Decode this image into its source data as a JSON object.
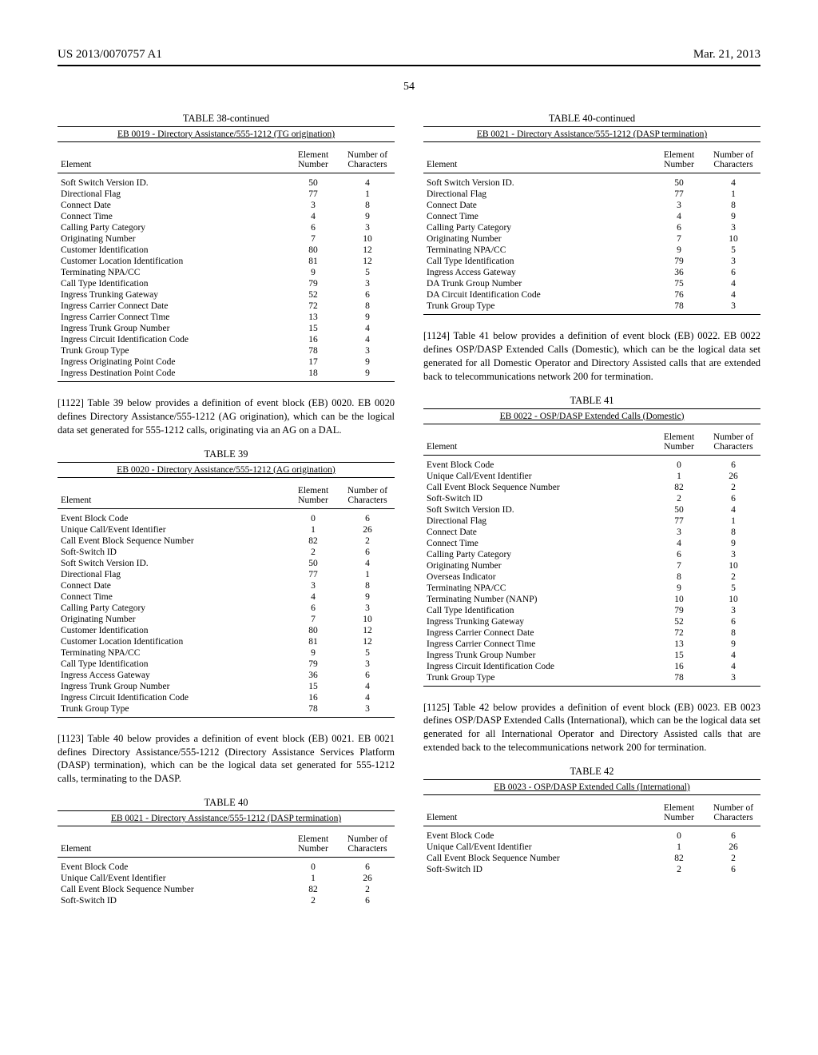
{
  "header": {
    "pub": "US 2013/0070757 A1",
    "date": "Mar. 21, 2013",
    "pagenum": "54"
  },
  "table38": {
    "label": "TABLE 38-continued",
    "caption": "EB 0019 - Directory Assistance/555-1212 (TG origination)",
    "head": {
      "c1": "Element",
      "c2": "Element\nNumber",
      "c3": "Number of\nCharacters"
    },
    "rows": [
      [
        "Soft Switch Version ID.",
        "50",
        "4"
      ],
      [
        "Directional Flag",
        "77",
        "1"
      ],
      [
        "Connect Date",
        "3",
        "8"
      ],
      [
        "Connect Time",
        "4",
        "9"
      ],
      [
        "Calling Party Category",
        "6",
        "3"
      ],
      [
        "Originating Number",
        "7",
        "10"
      ],
      [
        "Customer Identification",
        "80",
        "12"
      ],
      [
        "Customer Location Identification",
        "81",
        "12"
      ],
      [
        "Terminating NPA/CC",
        "9",
        "5"
      ],
      [
        "Call Type Identification",
        "79",
        "3"
      ],
      [
        "Ingress Trunking Gateway",
        "52",
        "6"
      ],
      [
        "Ingress Carrier Connect Date",
        "72",
        "8"
      ],
      [
        "Ingress Carrier Connect Time",
        "13",
        "9"
      ],
      [
        "Ingress Trunk Group Number",
        "15",
        "4"
      ],
      [
        "Ingress Circuit Identification Code",
        "16",
        "4"
      ],
      [
        "Trunk Group Type",
        "78",
        "3"
      ],
      [
        "Ingress Originating Point Code",
        "17",
        "9"
      ],
      [
        "Ingress Destination Point Code",
        "18",
        "9"
      ]
    ]
  },
  "para1122": "[1122]   Table 39 below provides a definition of event block (EB) 0020. EB 0020 defines Directory Assistance/555-1212 (AG origination), which can be the logical data set generated for 555-1212 calls, originating via an AG on a DAL.",
  "table39": {
    "label": "TABLE 39",
    "caption": "EB 0020 - Directory Assistance/555-1212 (AG origination)",
    "head": {
      "c1": "Element",
      "c2": "Element\nNumber",
      "c3": "Number of\nCharacters"
    },
    "rows": [
      [
        "Event Block Code",
        "0",
        "6"
      ],
      [
        "Unique Call/Event Identifier",
        "1",
        "26"
      ],
      [
        "Call Event Block Sequence Number",
        "82",
        "2"
      ],
      [
        "Soft-Switch ID",
        "2",
        "6"
      ],
      [
        "Soft Switch Version ID.",
        "50",
        "4"
      ],
      [
        "Directional Flag",
        "77",
        "1"
      ],
      [
        "Connect Date",
        "3",
        "8"
      ],
      [
        "Connect Time",
        "4",
        "9"
      ],
      [
        "Calling Party Category",
        "6",
        "3"
      ],
      [
        "Originating Number",
        "7",
        "10"
      ],
      [
        "Customer Identification",
        "80",
        "12"
      ],
      [
        "Customer Location Identification",
        "81",
        "12"
      ],
      [
        "Terminating NPA/CC",
        "9",
        "5"
      ],
      [
        "Call Type Identification",
        "79",
        "3"
      ],
      [
        "Ingress Access Gateway",
        "36",
        "6"
      ],
      [
        "Ingress Trunk Group Number",
        "15",
        "4"
      ],
      [
        "Ingress Circuit Identification Code",
        "16",
        "4"
      ],
      [
        "Trunk Group Type",
        "78",
        "3"
      ]
    ]
  },
  "para1123": "[1123]   Table 40 below provides a definition of event block (EB) 0021. EB 0021 defines Directory Assistance/555-1212 (Directory Assistance Services Platform (DASP) termination), which can be the logical data set generated for 555-1212 calls, terminating to the DASP.",
  "table40a": {
    "label": "TABLE 40",
    "caption": "EB 0021 - Directory Assistance/555-1212 (DASP termination)",
    "head": {
      "c1": "Element",
      "c2": "Element\nNumber",
      "c3": "Number of\nCharacters"
    },
    "rows": [
      [
        "Event Block Code",
        "0",
        "6"
      ],
      [
        "Unique Call/Event Identifier",
        "1",
        "26"
      ],
      [
        "Call Event Block Sequence Number",
        "82",
        "2"
      ],
      [
        "Soft-Switch ID",
        "2",
        "6"
      ]
    ]
  },
  "table40b": {
    "label": "TABLE 40-continued",
    "caption": "EB 0021 - Directory Assistance/555-1212 (DASP termination)",
    "head": {
      "c1": "Element",
      "c2": "Element\nNumber",
      "c3": "Number of\nCharacters"
    },
    "rows": [
      [
        "Soft Switch Version ID.",
        "50",
        "4"
      ],
      [
        "Directional Flag",
        "77",
        "1"
      ],
      [
        "Connect Date",
        "3",
        "8"
      ],
      [
        "Connect Time",
        "4",
        "9"
      ],
      [
        "Calling Party Category",
        "6",
        "3"
      ],
      [
        "Originating Number",
        "7",
        "10"
      ],
      [
        "Terminating NPA/CC",
        "9",
        "5"
      ],
      [
        "Call Type Identification",
        "79",
        "3"
      ],
      [
        "Ingress Access Gateway",
        "36",
        "6"
      ],
      [
        "DA Trunk Group Number",
        "75",
        "4"
      ],
      [
        "DA Circuit Identification Code",
        "76",
        "4"
      ],
      [
        "Trunk Group Type",
        "78",
        "3"
      ]
    ]
  },
  "para1124": "[1124]   Table 41 below provides a definition of event block (EB) 0022. EB 0022 defines OSP/DASP Extended Calls (Domestic), which can be the logical data set generated for all Domestic Operator and Directory Assisted calls that are extended back to telecommunications network 200 for termination.",
  "table41": {
    "label": "TABLE 41",
    "caption": "EB 0022 - OSP/DASP Extended Calls (Domestic)",
    "head": {
      "c1": "Element",
      "c2": "Element\nNumber",
      "c3": "Number of\nCharacters"
    },
    "rows": [
      [
        "Event Block Code",
        "0",
        "6"
      ],
      [
        "Unique Call/Event Identifier",
        "1",
        "26"
      ],
      [
        "Call Event Block Sequence Number",
        "82",
        "2"
      ],
      [
        "Soft-Switch ID",
        "2",
        "6"
      ],
      [
        "Soft Switch Version ID.",
        "50",
        "4"
      ],
      [
        "Directional Flag",
        "77",
        "1"
      ],
      [
        "Connect Date",
        "3",
        "8"
      ],
      [
        "Connect Time",
        "4",
        "9"
      ],
      [
        "Calling Party Category",
        "6",
        "3"
      ],
      [
        "Originating Number",
        "7",
        "10"
      ],
      [
        "Overseas Indicator",
        "8",
        "2"
      ],
      [
        "Terminating NPA/CC",
        "9",
        "5"
      ],
      [
        "Terminating Number (NANP)",
        "10",
        "10"
      ],
      [
        "Call Type Identification",
        "79",
        "3"
      ],
      [
        "Ingress Trunking Gateway",
        "52",
        "6"
      ],
      [
        "Ingress Carrier Connect Date",
        "72",
        "8"
      ],
      [
        "Ingress Carrier Connect Time",
        "13",
        "9"
      ],
      [
        "Ingress Trunk Group Number",
        "15",
        "4"
      ],
      [
        "Ingress Circuit Identification Code",
        "16",
        "4"
      ],
      [
        "Trunk Group Type",
        "78",
        "3"
      ]
    ]
  },
  "para1125": "[1125]   Table 42 below provides a definition of event block (EB) 0023. EB 0023 defines OSP/DASP Extended Calls (International), which can be the logical data set generated for all International Operator and Directory Assisted calls that are extended back to the telecommunications network 200 for termination.",
  "table42": {
    "label": "TABLE 42",
    "caption": "EB 0023 - OSP/DASP Extended Calls (International)",
    "head": {
      "c1": "Element",
      "c2": "Element\nNumber",
      "c3": "Number of\nCharacters"
    },
    "rows": [
      [
        "Event Block Code",
        "0",
        "6"
      ],
      [
        "Unique Call/Event Identifier",
        "1",
        "26"
      ],
      [
        "Call Event Block Sequence Number",
        "82",
        "2"
      ],
      [
        "Soft-Switch ID",
        "2",
        "6"
      ]
    ]
  }
}
